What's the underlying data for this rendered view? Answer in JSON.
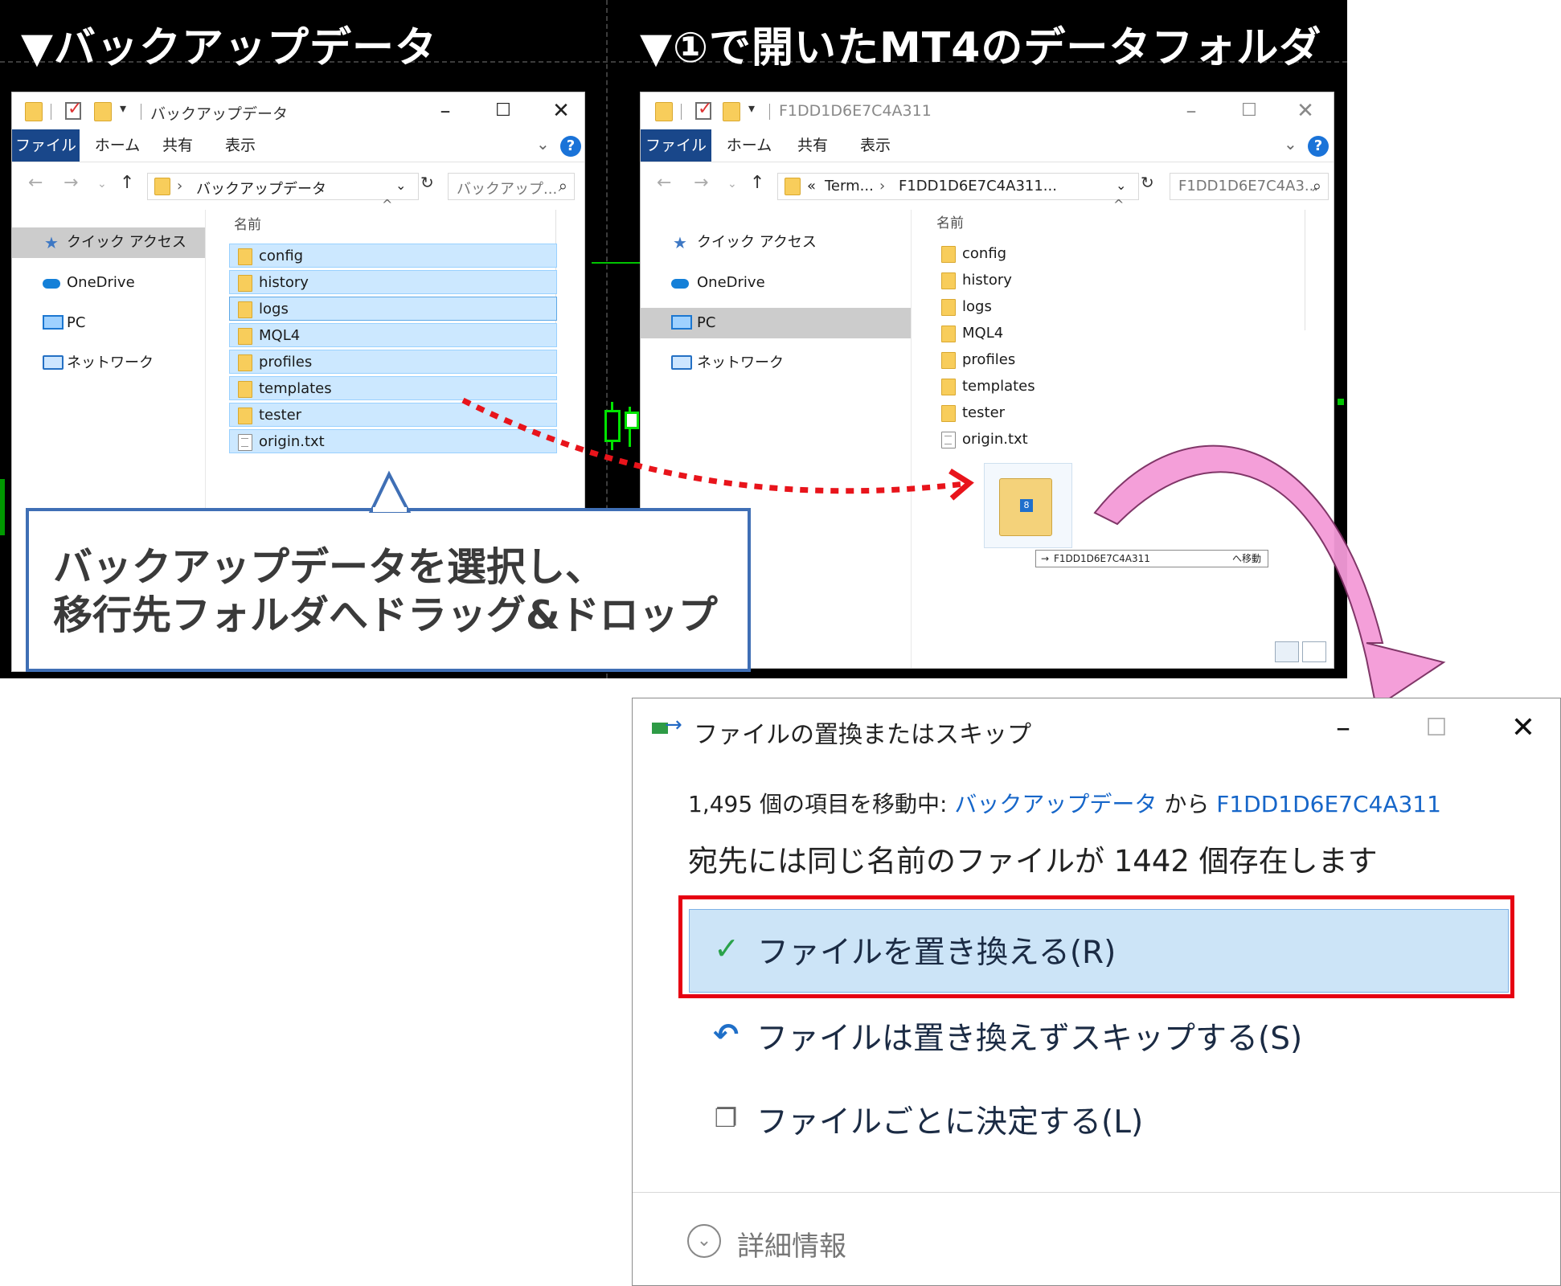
{
  "banners": {
    "left": "▼バックアップデータ",
    "right": "▼①で開いたMT4のデータフォルダ"
  },
  "left_window": {
    "title": "バックアップデータ",
    "ribbon_tabs": [
      "ファイル",
      "ホーム",
      "共有",
      "表示"
    ],
    "address": "バックアップデータ",
    "search_placeholder": "バックアップ...",
    "column_header": "名前",
    "nav": [
      "クイック アクセス",
      "OneDrive",
      "PC",
      "ネットワーク"
    ],
    "files": [
      "config",
      "history",
      "logs",
      "MQL4",
      "profiles",
      "templates",
      "tester",
      "origin.txt"
    ]
  },
  "right_window": {
    "title": "F1DD1D6E7C4A311",
    "ribbon_tabs": [
      "ファイル",
      "ホーム",
      "共有",
      "表示"
    ],
    "address_prefix": "«",
    "address_part1": "Term...",
    "address_part2": "F1DD1D6E7C4A311...",
    "search_placeholder": "F1DD1D6E7C4A3...",
    "column_header": "名前",
    "nav": [
      "クイック アクセス",
      "OneDrive",
      "PC",
      "ネットワーク"
    ],
    "files": [
      "config",
      "history",
      "logs",
      "MQL4",
      "profiles",
      "templates",
      "tester",
      "origin.txt"
    ]
  },
  "drag": {
    "badge_count": "8",
    "tooltip_target": "F1DD1D6E7C4A311",
    "tooltip_action": "へ移動"
  },
  "callout": {
    "line1": "バックアップデータを選択し、",
    "line2": "移行先フォルダへドラッグ&ドロップ"
  },
  "dialog": {
    "title": "ファイルの置換またはスキップ",
    "move_prefix": "1,495 個の項目を移動中: ",
    "source": "バックアップデータ",
    "from_word": " から ",
    "destination": "F1DD1D6E7C4A311",
    "conflict_text": "宛先には同じ名前のファイルが 1442 個存在します",
    "options": {
      "replace": "ファイルを置き換える(R)",
      "skip": "ファイルは置き換えずスキップする(S)",
      "decide": "ファイルごとに決定する(L)"
    },
    "details": "詳細情報"
  },
  "colors": {
    "highlight_border": "#e60012",
    "callout_border": "#3f6fb5",
    "ribbon_file_tab": "#19478a",
    "selection": "#cce8ff",
    "arrow_pink": "#f08ad0",
    "link_blue": "#1666c9"
  }
}
